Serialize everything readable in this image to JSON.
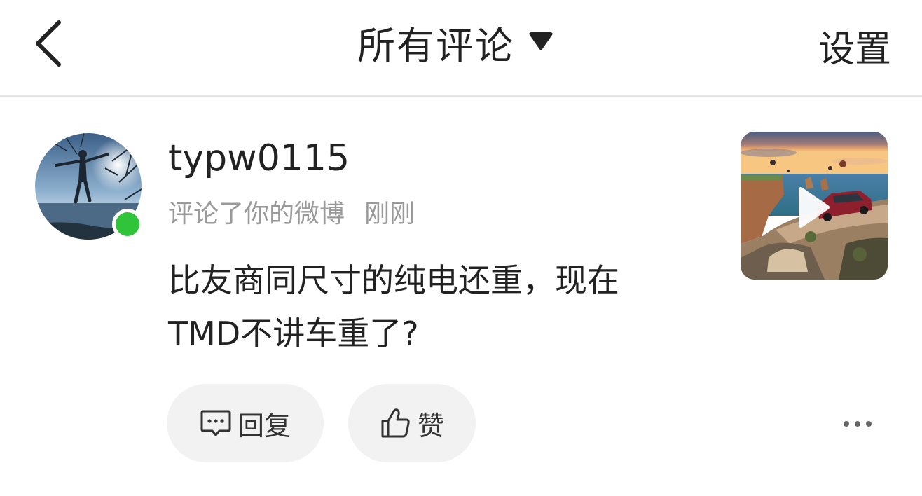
{
  "header": {
    "back_icon": "chevron-left-icon",
    "title": "所有评论",
    "title_dropdown_icon": "caret-down-icon",
    "settings_label": "设置"
  },
  "comment": {
    "username": "typw0115",
    "action_text": "评论了你的微博",
    "time": "刚刚",
    "text_line1": "比友商同尺寸的纯电还重，现在",
    "text_line2": "TMD不讲车重了?",
    "online_status_color": "#2fc43a",
    "thumbnail_icon": "play-icon",
    "reply_label": "回复",
    "reply_icon": "comment-icon",
    "like_label": "赞",
    "like_icon": "thumbs-up-icon",
    "more_icon": "more-dots-icon"
  }
}
